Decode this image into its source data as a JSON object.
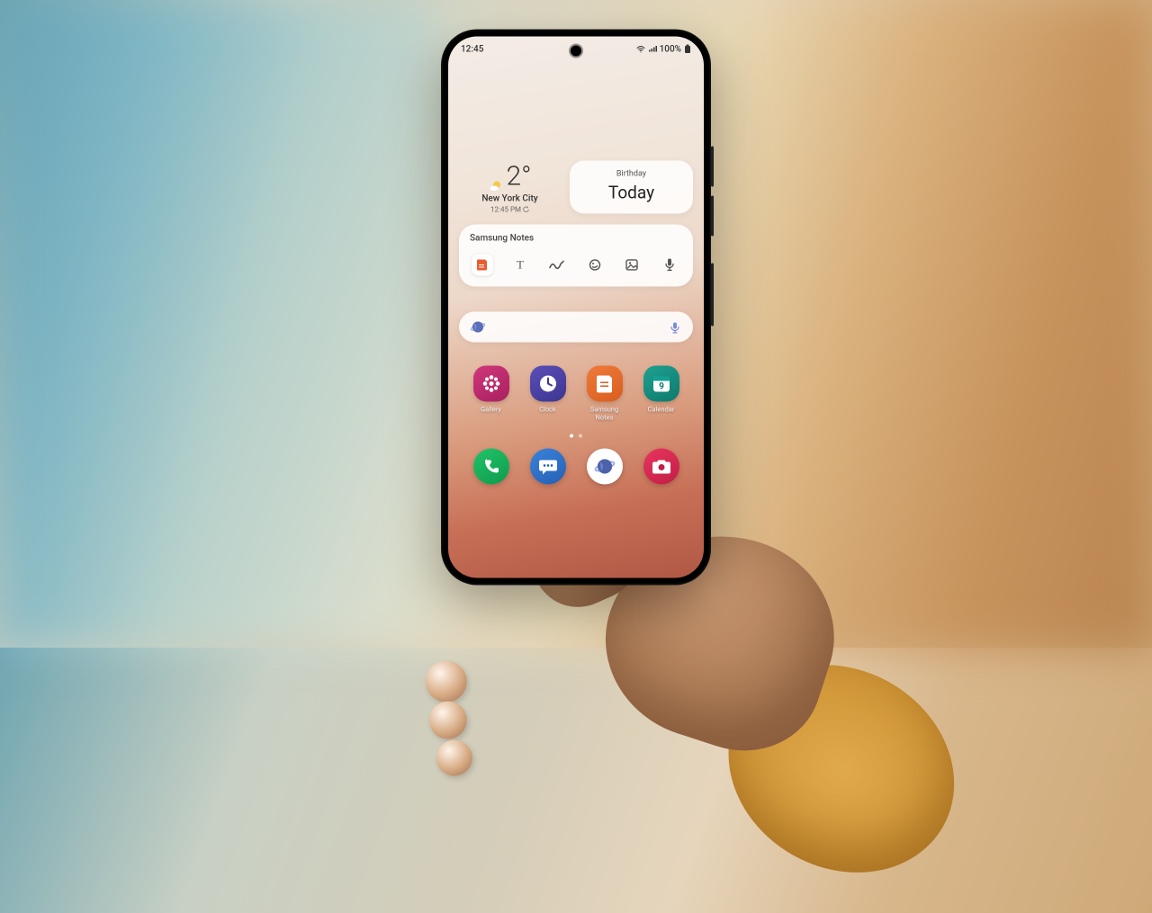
{
  "status": {
    "time": "12:45",
    "battery_text": "100%"
  },
  "weather": {
    "temp": "2°",
    "location": "New York City",
    "updated": "12:45 PM"
  },
  "calendar": {
    "event_label": "Birthday",
    "day_label": "Today"
  },
  "notes": {
    "title": "Samsung Notes"
  },
  "apps": [
    {
      "label": "Gallery"
    },
    {
      "label": "Clock"
    },
    {
      "label": "Samsung\nNotes"
    },
    {
      "label": "Calendar",
      "day": "9"
    }
  ]
}
